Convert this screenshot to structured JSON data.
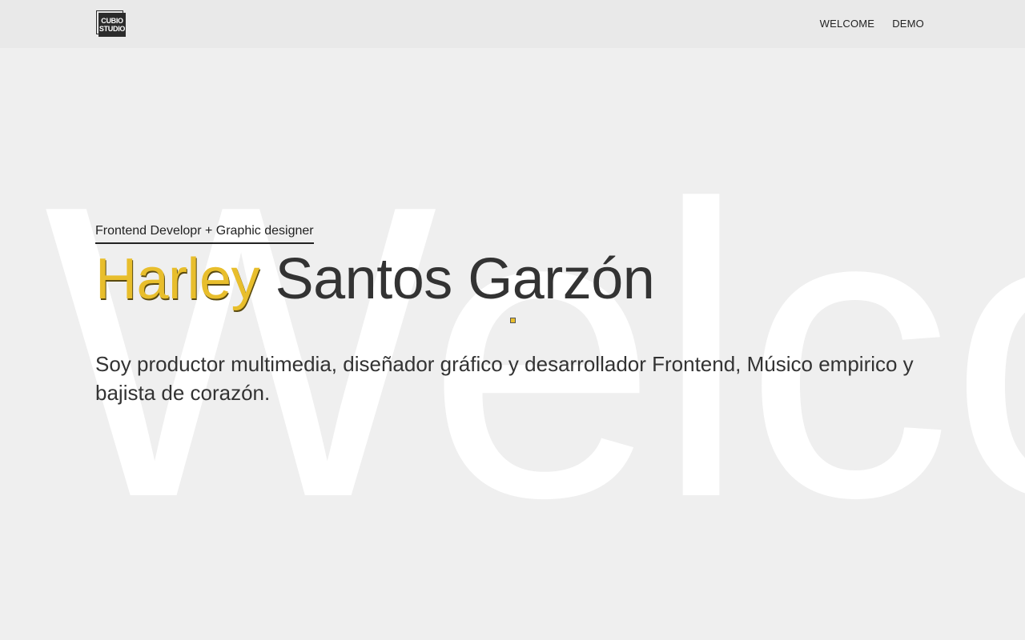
{
  "header": {
    "logo": {
      "line1": "CUBIO",
      "line2": "STUDIO"
    },
    "nav": [
      {
        "label": "WELCOME"
      },
      {
        "label": "DEMO"
      }
    ]
  },
  "background": {
    "word": "Welco"
  },
  "hero": {
    "role": "Frontend Developr + Graphic designer",
    "first_name": "Harley",
    "last_name": "Santos Garzón",
    "bio": "Soy productor multimedia, diseñador gráfico y desarrollador Frontend, Músico empirico y bajista de corazón."
  },
  "colors": {
    "accent": "#e8be2c",
    "text": "#333333",
    "background": "#efefef",
    "header_bg": "#e9e9e9"
  }
}
